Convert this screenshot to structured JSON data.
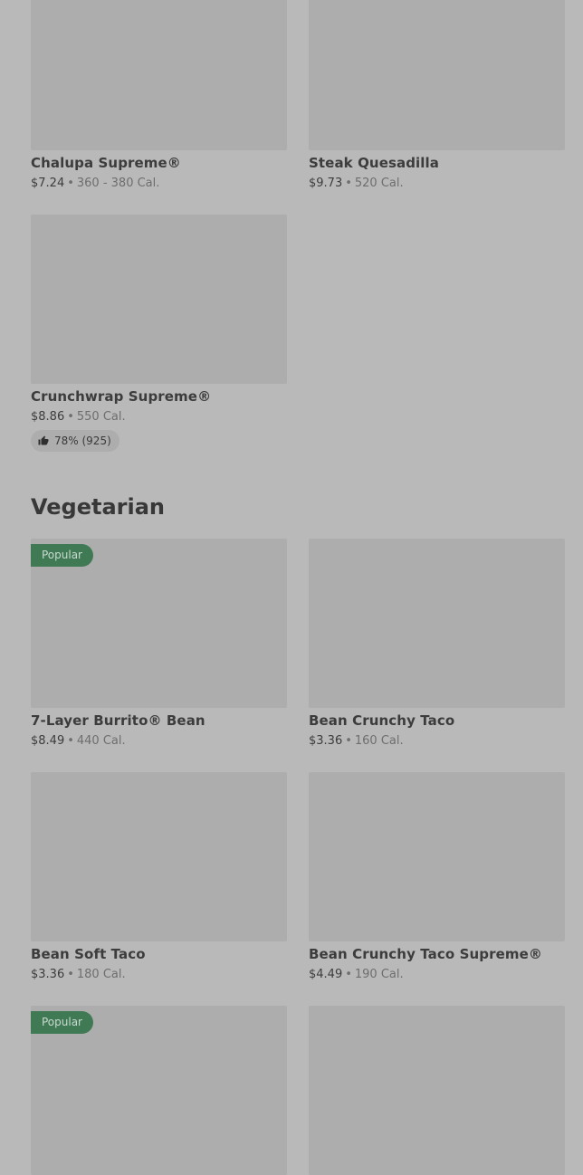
{
  "sections": [
    {
      "title": "",
      "items": [
        {
          "name": "Chalupa Supreme®",
          "price": "$7.24",
          "separator": "•",
          "calories": "360 - 380 Cal."
        },
        {
          "name": "Steak Quesadilla",
          "price": "$9.73",
          "separator": "•",
          "calories": "520 Cal."
        },
        {
          "name": "Crunchwrap Supreme®",
          "price": "$8.86",
          "separator": "•",
          "calories": "550 Cal.",
          "rating": "78% (925)",
          "rating_icon": "thumbs-up-icon"
        }
      ]
    },
    {
      "title": "Vegetarian",
      "items": [
        {
          "name": "7-Layer Burrito® Bean",
          "price": "$8.49",
          "separator": "•",
          "calories": "440 Cal.",
          "badge": "Popular"
        },
        {
          "name": "Bean Crunchy Taco",
          "price": "$3.36",
          "separator": "•",
          "calories": "160 Cal."
        },
        {
          "name": "Bean Soft Taco",
          "price": "$3.36",
          "separator": "•",
          "calories": "180 Cal."
        },
        {
          "name": "Bean Crunchy Taco Supreme®",
          "price": "$4.49",
          "separator": "•",
          "calories": "190 Cal."
        },
        {
          "badge": "Popular"
        },
        {}
      ]
    }
  ],
  "colors": {
    "background": "#b9b9b9",
    "image_placeholder": "#adadad",
    "badge": "#3f7a55"
  }
}
